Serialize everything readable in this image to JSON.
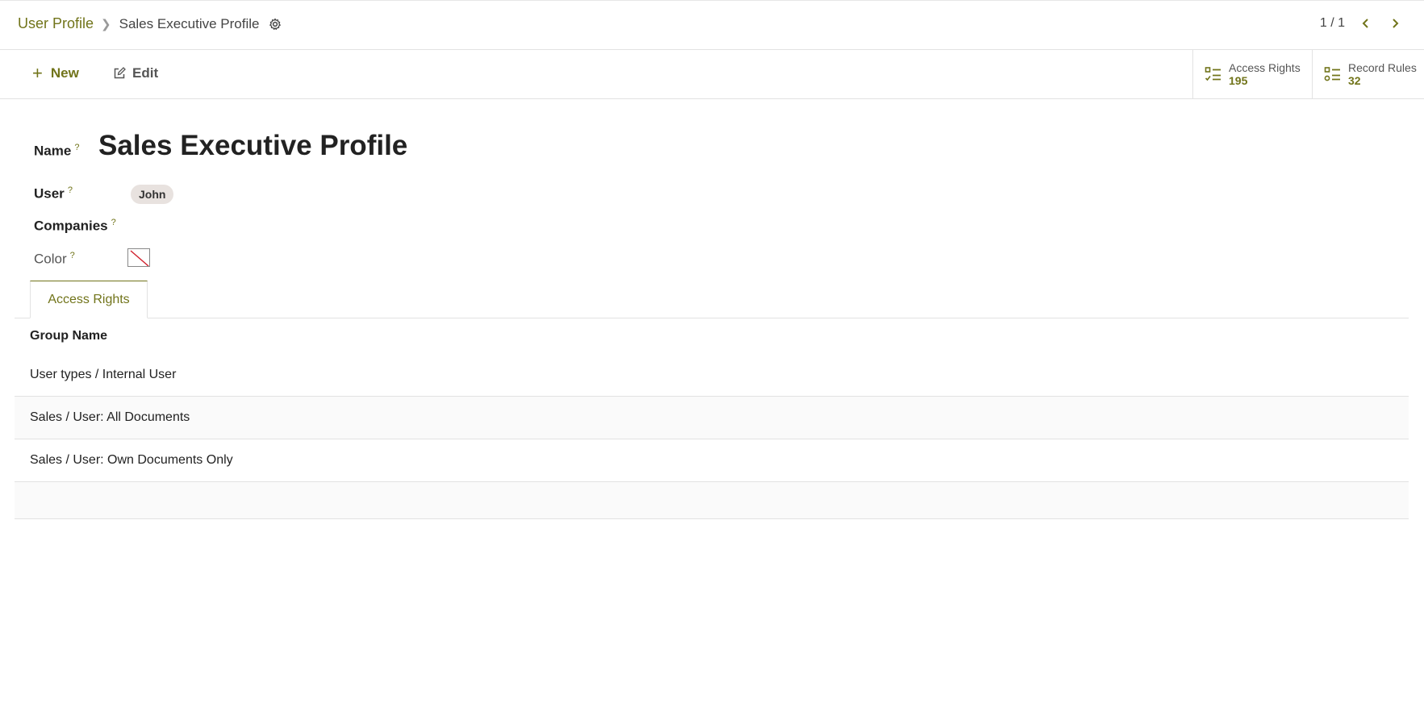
{
  "breadcrumb": {
    "root": "User Profile",
    "current": "Sales Executive Profile"
  },
  "pager": {
    "value": "1 / 1"
  },
  "actions": {
    "new_label": "New",
    "edit_label": "Edit"
  },
  "stat_buttons": {
    "access_rights": {
      "label": "Access Rights",
      "value": "195"
    },
    "record_rules": {
      "label": "Record Rules",
      "value": "32"
    }
  },
  "form": {
    "name_label": "Name",
    "name_value": "Sales Executive Profile",
    "user_label": "User",
    "user_tag": "John",
    "companies_label": "Companies",
    "color_label": "Color",
    "help_mark": "?"
  },
  "tabs": [
    {
      "label": "Access Rights",
      "active": true
    }
  ],
  "table": {
    "header": "Group Name",
    "rows": [
      "User types / Internal User",
      "Sales / User: All Documents",
      "Sales / User: Own Documents Only"
    ]
  },
  "colors": {
    "accent": "#71741a",
    "tag_bg": "#e8e2df",
    "border": "#e2e2e2"
  },
  "icons": {
    "breadcrumb_separator": "chevron-right-icon",
    "settings": "gear-icon",
    "pager_prev": "chevron-left-icon",
    "pager_next": "chevron-right-icon",
    "new": "plus-icon",
    "edit": "edit-icon",
    "stat": "list-check-icon",
    "color_none": "no-color-icon"
  }
}
